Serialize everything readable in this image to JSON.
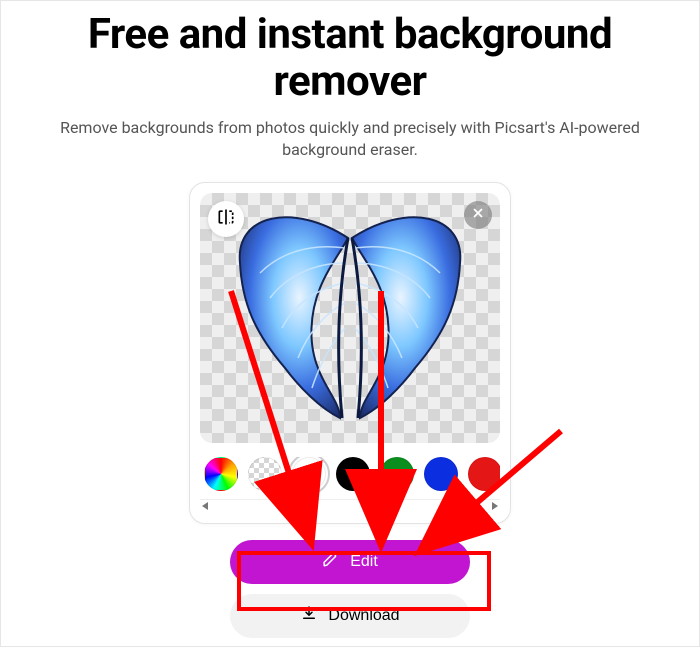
{
  "header": {
    "title": "Free and instant background remover",
    "subtitle": "Remove backgrounds from photos quickly and precisely with Picsart's AI-powered background eraser."
  },
  "editor": {
    "icons": {
      "split": "compare-split-icon",
      "close": "close-icon"
    },
    "swatches": [
      {
        "name": "rainbow",
        "css": "rainbow",
        "selected": false
      },
      {
        "name": "transparent",
        "css": "transparent",
        "selected": false
      },
      {
        "name": "white",
        "css": "white",
        "selected": true
      },
      {
        "name": "black",
        "css": "black",
        "selected": false
      },
      {
        "name": "green",
        "css": "green",
        "selected": false
      },
      {
        "name": "blue",
        "css": "blue",
        "selected": false
      },
      {
        "name": "red",
        "css": "red",
        "selected": false
      }
    ]
  },
  "actions": {
    "edit_label": "Edit",
    "download_label": "Download",
    "icons": {
      "edit": "pencil-icon",
      "download": "download-icon"
    }
  },
  "annotation": {
    "arrow_color": "#ff0000",
    "highlight_target": "download-button"
  }
}
